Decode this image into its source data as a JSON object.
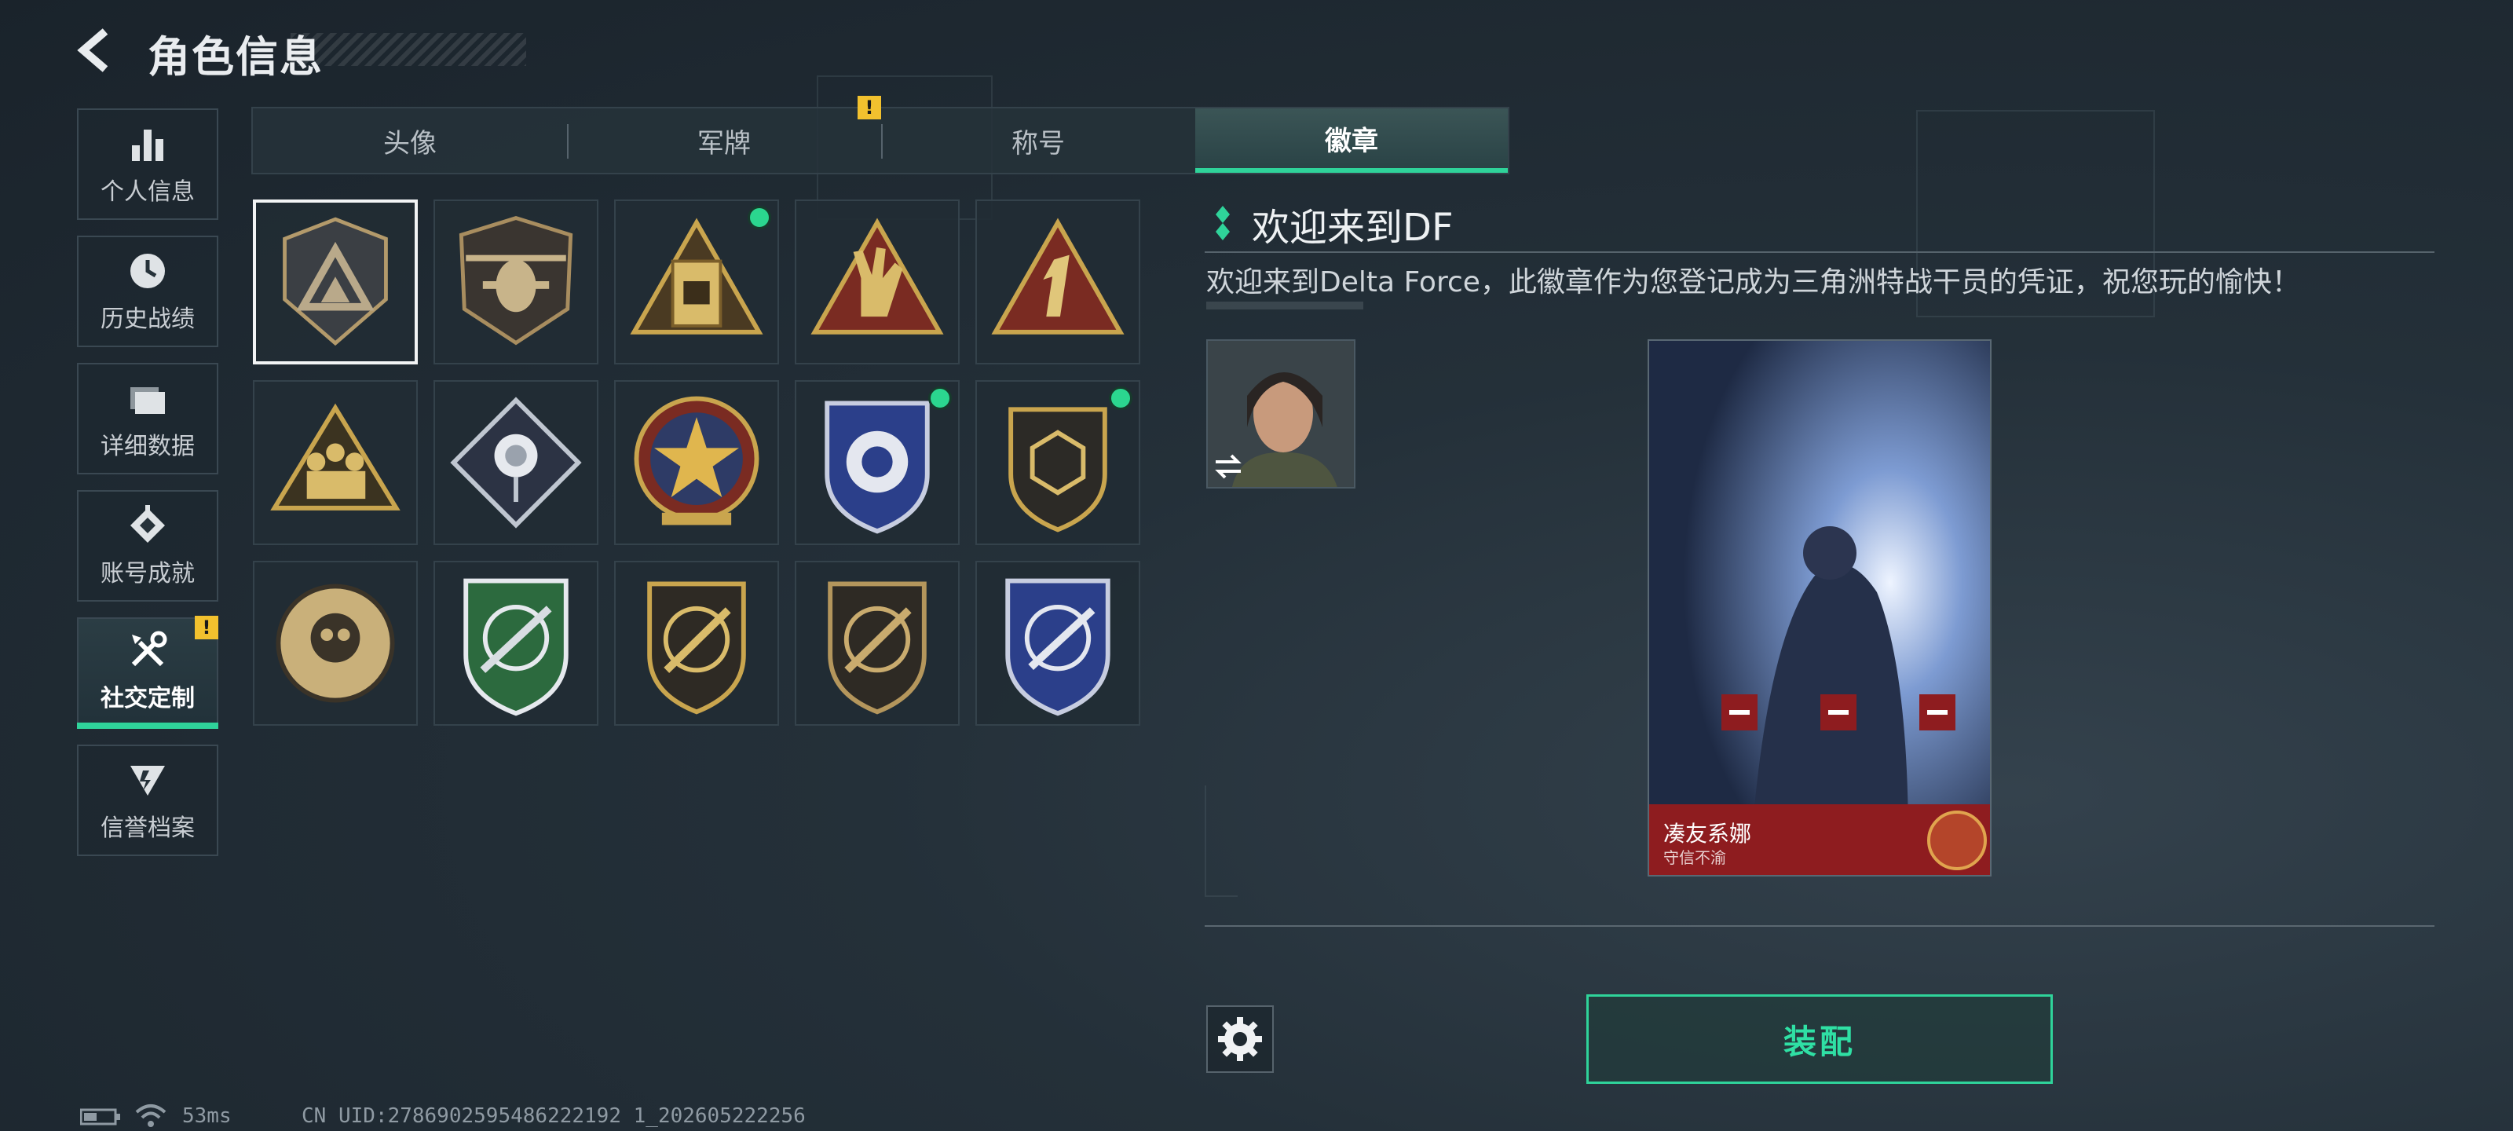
{
  "header": {
    "title": "角色信息"
  },
  "sidebar": {
    "items": [
      {
        "label": "个人信息",
        "icon": "bar-chart-icon"
      },
      {
        "label": "历史战绩",
        "icon": "clock-icon"
      },
      {
        "label": "详细数据",
        "icon": "folder-icon"
      },
      {
        "label": "账号成就",
        "icon": "achievement-icon"
      },
      {
        "label": "社交定制",
        "icon": "tools-icon",
        "active": true,
        "alert": "!"
      },
      {
        "label": "信誉档案",
        "icon": "reputation-icon"
      }
    ]
  },
  "tabs": [
    {
      "label": "头像"
    },
    {
      "label": "军牌",
      "alert": "!"
    },
    {
      "label": "称号"
    },
    {
      "label": "徽章",
      "active": true
    }
  ],
  "badges": [
    {
      "name": "delta-triangle-badge",
      "selected": true,
      "new": false
    },
    {
      "name": "helicopter-badge",
      "new": false
    },
    {
      "name": "gate-badge",
      "new": true
    },
    {
      "name": "hand-sign-badge",
      "new": false
    },
    {
      "name": "number-one-badge",
      "new": false
    },
    {
      "name": "soldiers-badge",
      "new": false
    },
    {
      "name": "rose-badge",
      "new": false
    },
    {
      "name": "star-medal-badge",
      "new": false
    },
    {
      "name": "blue-shield-badge",
      "new": true
    },
    {
      "name": "hexagon-shield-badge",
      "new": true
    },
    {
      "name": "skull-emblem-badge",
      "new": false
    },
    {
      "name": "green-rifle-badge",
      "new": false
    },
    {
      "name": "gold-rifle-badge",
      "new": false
    },
    {
      "name": "bronze-rifle-badge",
      "new": false
    },
    {
      "name": "blue-knife-badge",
      "new": false
    }
  ],
  "detail": {
    "title": "欢迎来到DF",
    "description": "欢迎来到Delta Force，此徽章作为您登记成为三角洲特战干员的凭证，祝您玩的愉快！"
  },
  "card": {
    "name": "凑友系娜",
    "subtitle": "守信不渝"
  },
  "actions": {
    "equip_label": "装配"
  },
  "status": {
    "ping": "53ms",
    "uid": "CN UID:2786902595486222192 1_202605222256"
  },
  "colors": {
    "accent": "#2fd39a",
    "alert": "#f2c12e",
    "card_banner": "#8e1c1f"
  }
}
